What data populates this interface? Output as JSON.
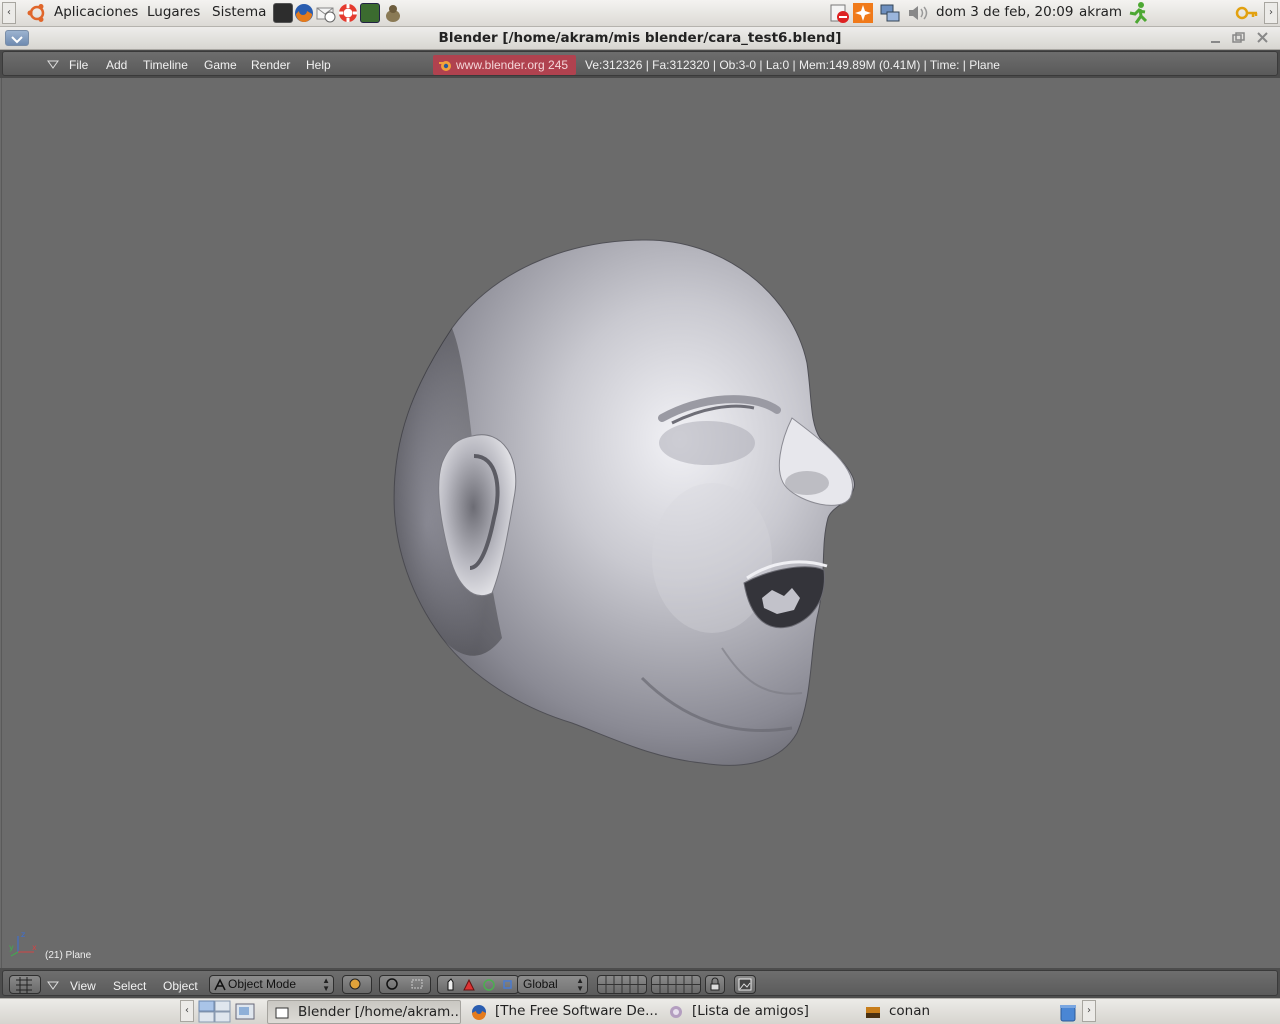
{
  "top_panel": {
    "apps_label": "Aplicaciones",
    "places_label": "Lugares",
    "system_label": "Sistema",
    "clock": "dom  3 de feb, 20:09",
    "user": "akram"
  },
  "window": {
    "title": "Blender [/home/akram/mis blender/cara_test6.blend]"
  },
  "blender_header": {
    "menus": [
      "File",
      "Add",
      "Timeline",
      "Game",
      "Render",
      "Help"
    ],
    "website_label": "www.blender.org 245",
    "stats": "Ve:312326 | Fa:312320 | Ob:3-0 | La:0  | Mem:149.89M (0.41M)  | Time: | Plane"
  },
  "viewport": {
    "object_label": "(21) Plane",
    "axis_x": "x",
    "axis_y": "y",
    "axis_z": "z"
  },
  "blender_footer": {
    "view_label": "View",
    "select_label": "Select",
    "object_label": "Object",
    "mode_value": "Object Mode",
    "orientation_value": "Global"
  },
  "taskbar": {
    "tasks": [
      {
        "label": "Blender [/home/akram...",
        "active": true
      },
      {
        "label": "[The Free Software De...",
        "active": false
      },
      {
        "label": "[Lista de amigos]",
        "active": false
      },
      {
        "label": "conan",
        "active": false
      }
    ]
  },
  "colors": {
    "viewport_bg": "#6b6b6b",
    "header_bg": "#5f5f5f",
    "website_badge": "#b0424f",
    "panel_bg": "#e6e4e0"
  }
}
